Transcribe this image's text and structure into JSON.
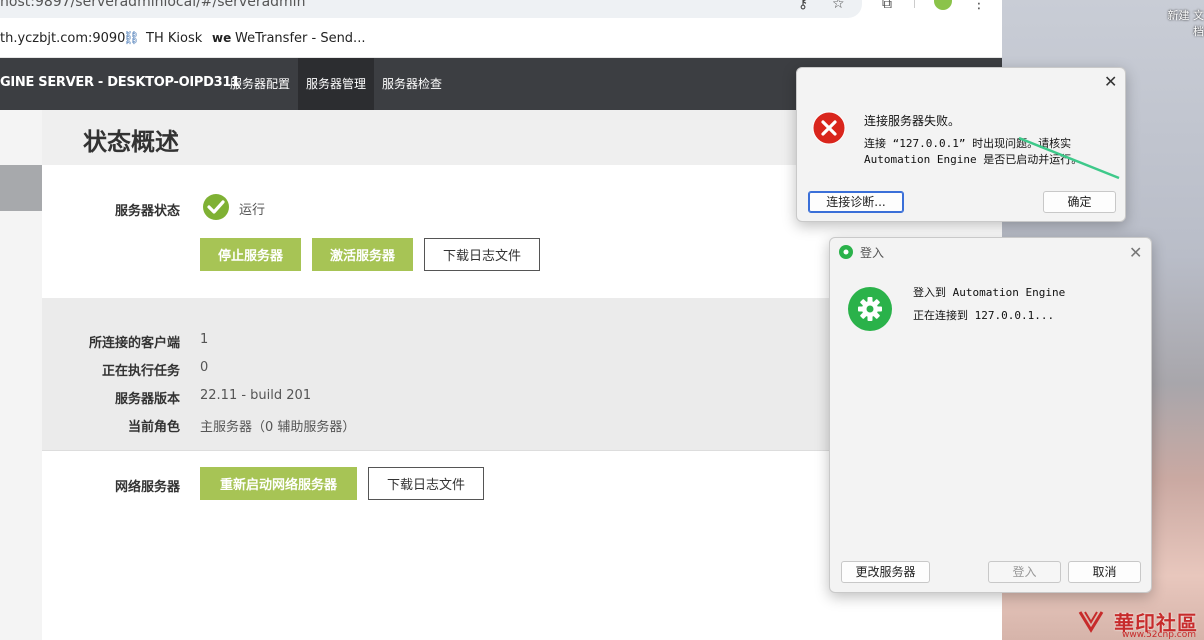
{
  "browser": {
    "url": "host:9897/serveradminlocal/#/serveradmin",
    "bookmarks": [
      {
        "label": "th.yczbjt.com:9090",
        "icon": "none"
      },
      {
        "label": "TH Kiosk",
        "icon": "link-icon"
      },
      {
        "label": "WeTransfer - Send...",
        "icon": "wetransfer-icon",
        "icon_text": "we"
      }
    ]
  },
  "app": {
    "title": "GINE SERVER - DESKTOP-OIPD311",
    "nav": [
      {
        "label": "服务器配置",
        "active": false
      },
      {
        "label": "服务器管理",
        "active": true
      },
      {
        "label": "服务器检查",
        "active": false
      }
    ]
  },
  "page": {
    "title": "状态概述",
    "server_status": {
      "label": "服务器状态",
      "value": "运行"
    },
    "buttons": {
      "stop": "停止服务器",
      "activate": "激活服务器",
      "download_log": "下载日志文件"
    },
    "info": [
      {
        "label": "所连接的客户端",
        "value": "1"
      },
      {
        "label": "正在执行任务",
        "value": "0"
      },
      {
        "label": "服务器版本",
        "value": "22.11 - build 201"
      },
      {
        "label": "当前角色",
        "value": "主服务器（0 辅助服务器）"
      }
    ],
    "web_server": {
      "label": "网络服务器",
      "restart": "重新启动网络服务器",
      "download_log": "下载日志文件"
    }
  },
  "error_dialog": {
    "title_line": "连接服务器失败。",
    "message_line1": "连接 “127.0.0.1” 时出现问题。请核实",
    "message_line2": "Automation Engine 是否已启动并运行。",
    "diagnose_button": "连接诊断...",
    "ok_button": "确定",
    "close_glyph": "✕"
  },
  "login_dialog": {
    "title": "登入",
    "line1": "登入到 Automation Engine",
    "line2": "正在连接到 127.0.0.1...",
    "change_server_button": "更改服务器",
    "login_button": "登入",
    "cancel_button": "取消",
    "close_glyph": "✕"
  },
  "desktop": {
    "label_line1": "新建 文",
    "label_line2": "档"
  },
  "watermark": {
    "text": "華印社區",
    "sub": "www.52cnp.com"
  },
  "colors": {
    "accent_green": "#a7c455",
    "nav_bg": "#3c3e42",
    "error_red": "#d9251c",
    "login_green": "#2ab24a"
  }
}
